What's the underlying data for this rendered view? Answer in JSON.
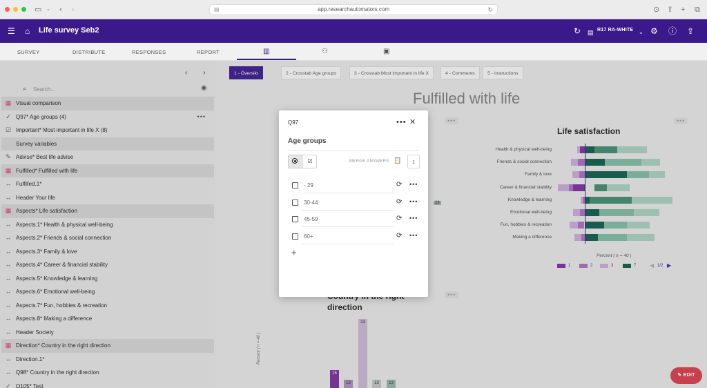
{
  "browser": {
    "url": "app.researchautomators.com"
  },
  "header": {
    "title": "Life survey Seb2",
    "report_selector": "R17 RA-WHITE"
  },
  "tabs": [
    "SURVEY",
    "DISTRIBUTE",
    "RESPONSES",
    "REPORT"
  ],
  "sidebar": {
    "search_placeholder": "Search...",
    "items": [
      {
        "label": "Visual comparison",
        "icon": "grid-icon",
        "shaded": true
      },
      {
        "label": "Q97* Age groups (4)",
        "icon": "check-circle-icon",
        "shaded": false,
        "menu": "•••"
      },
      {
        "label": "Important* Most important in life X (8)",
        "icon": "checkbox-icon",
        "shaded": false
      },
      {
        "label": "Survey variables",
        "icon": "",
        "shaded": true
      },
      {
        "label": "Advise* Best life advise",
        "icon": "edit-box-icon",
        "shaded": false
      },
      {
        "label": "Fulfilled* Fulfilled with life",
        "icon": "grid-icon",
        "shaded": true
      },
      {
        "label": "Fulfilled.1*",
        "icon": "arrows-h-icon",
        "shaded": false
      },
      {
        "label": "Header Your life",
        "icon": "arrows-h-icon",
        "shaded": false
      },
      {
        "label": "Aspects* Life satisfaction",
        "icon": "grid-icon",
        "shaded": true
      },
      {
        "label": "Aspects.1* Health & physical well-being",
        "icon": "arrows-h-icon",
        "shaded": false
      },
      {
        "label": "Aspects.2* Friends & social connection",
        "icon": "arrows-h-icon",
        "shaded": false
      },
      {
        "label": "Aspects.3* Family & love",
        "icon": "arrows-h-icon",
        "shaded": false
      },
      {
        "label": "Aspects.4* Career & financial stability",
        "icon": "arrows-h-icon",
        "shaded": false
      },
      {
        "label": "Aspects.5* Knowledge & learning",
        "icon": "arrows-h-icon",
        "shaded": false
      },
      {
        "label": "Aspects.6* Emotional well-being",
        "icon": "arrows-h-icon",
        "shaded": false
      },
      {
        "label": "Aspects.7* Fun, hobbies & recreation",
        "icon": "arrows-h-icon",
        "shaded": false
      },
      {
        "label": "Aspects.8* Making a difference",
        "icon": "arrows-h-icon",
        "shaded": false
      },
      {
        "label": "Header Society",
        "icon": "arrows-h-icon",
        "shaded": false
      },
      {
        "label": "Direction* Country in the right direction",
        "icon": "grid-icon",
        "shaded": true
      },
      {
        "label": "Direction.1*",
        "icon": "arrows-h-icon",
        "shaded": false
      },
      {
        "label": "Q98* Country in the right direction",
        "icon": "arrows-h-icon",
        "shaded": false
      },
      {
        "label": "Q105* Test",
        "icon": "check-circle-icon",
        "shaded": false
      }
    ]
  },
  "report_tabs": [
    {
      "label": "1 - Översikt",
      "active": true
    },
    {
      "label": "2 - Crosstab Age groups",
      "active": false
    },
    {
      "label": "3 - Crosstab Most important in life X",
      "active": false
    },
    {
      "label": "4 - Comments",
      "active": false
    },
    {
      "label": "5 - Instructions",
      "active": false
    }
  ],
  "main": {
    "title": "Fulfilled with life",
    "hidden_value": "28",
    "edit_label": "EDIT"
  },
  "life_satisfaction": {
    "title": "Life satisfaction",
    "percent_label": "Percent ( n = 40 )",
    "legend": [
      "1",
      "2",
      "3",
      "7"
    ],
    "pager": "1/2",
    "colors": [
      "#7b2d9e",
      "#a56bbf",
      "#c6a8d6",
      "#0e5c4c",
      "#3f8a6e",
      "#7eb8a2",
      "#a6cdbd"
    ],
    "rows": [
      "Health & physical well-being",
      "Friends & social connection",
      "Family & love",
      "Career & financial stability",
      "Knowledge & learning",
      "Emotional well-being",
      "Fun, hobbies & recreation",
      "Making a difference"
    ]
  },
  "country": {
    "title": "Country in the right direction",
    "y_axis": "Percent ( n = 40 )",
    "bar_values": [
      "15",
      "13",
      "33",
      "13",
      "13"
    ]
  },
  "modal": {
    "id": "Q97",
    "title": "Age groups",
    "merge_label": "MERGE ANSWERS",
    "answers": [
      "- 29",
      "30-44",
      "45-59",
      "60+"
    ],
    "add_symbol": "+"
  }
}
